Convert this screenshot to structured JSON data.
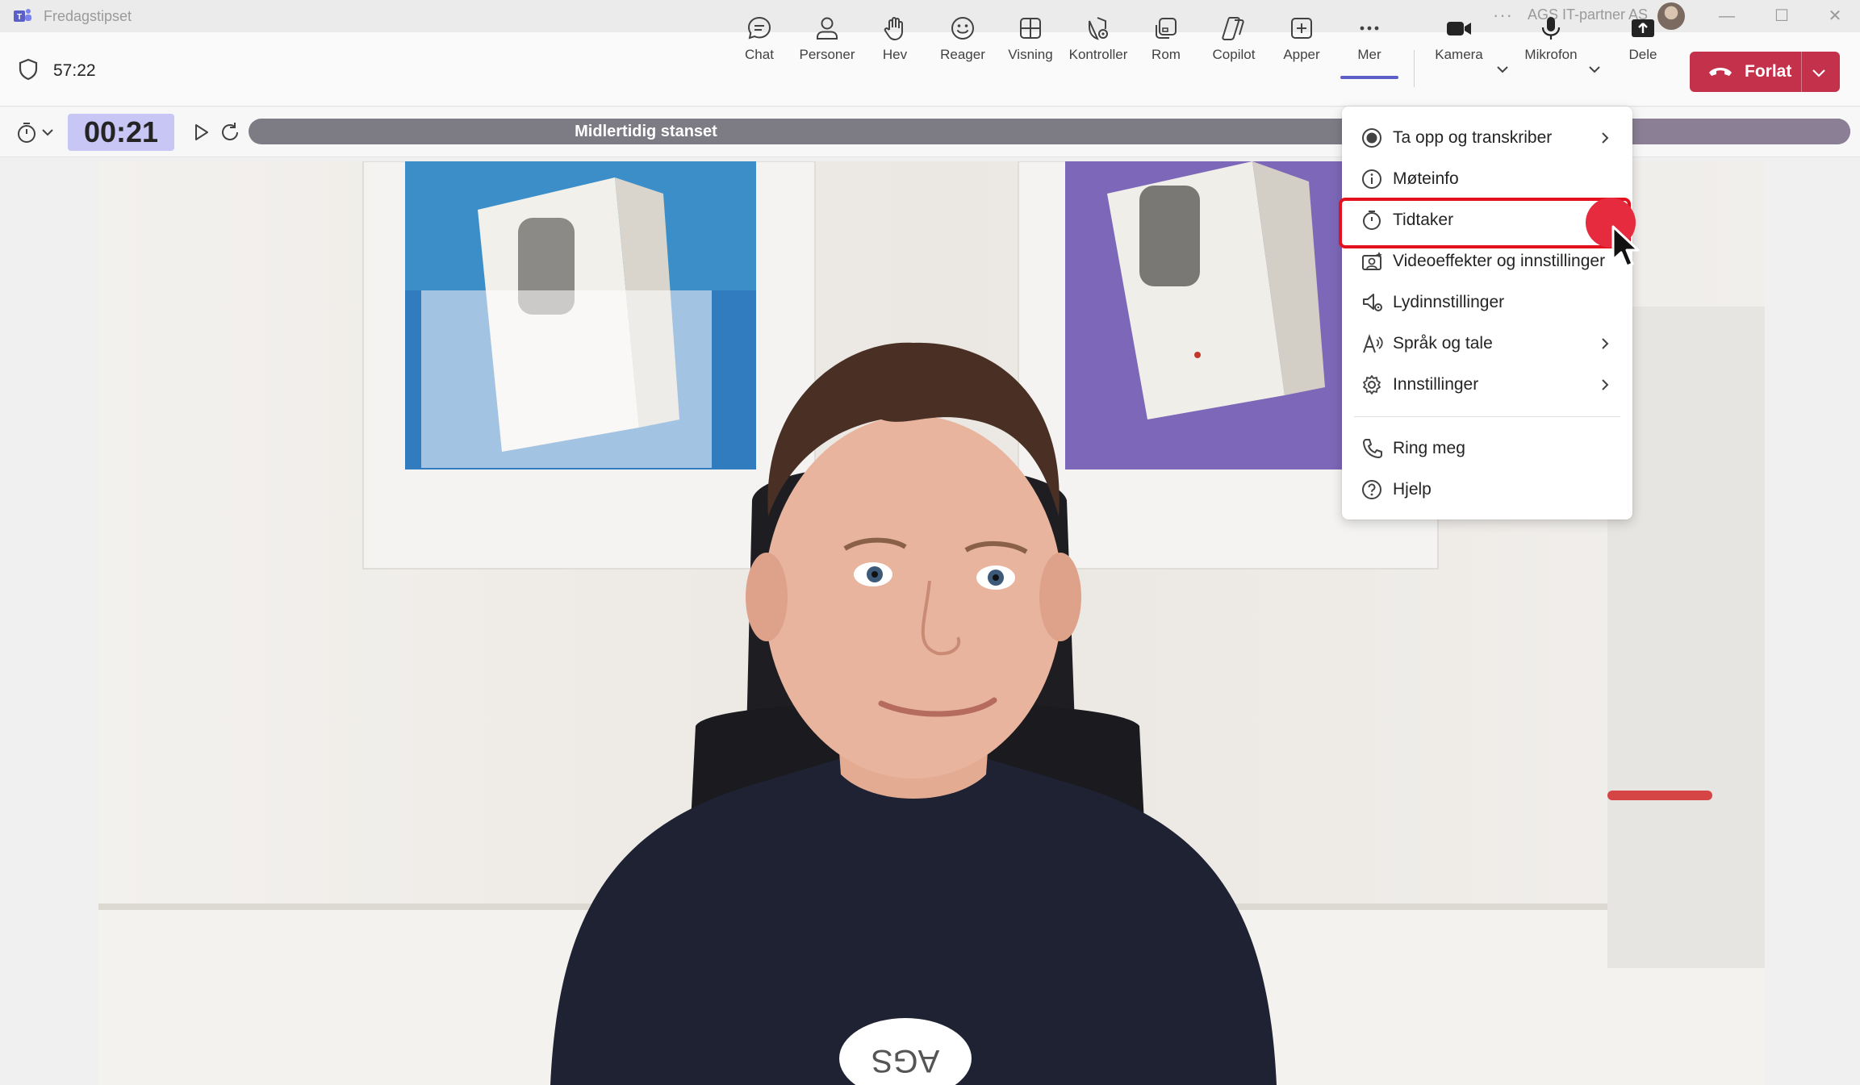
{
  "window": {
    "title": "Fredagstipset",
    "tenant": "AGS IT-partner AS",
    "more_icon": "ellipsis-icon",
    "controls": [
      "minimize-icon",
      "maximize-icon",
      "close-icon"
    ]
  },
  "meeting": {
    "duration": "57:22"
  },
  "toolbar": {
    "chat": "Chat",
    "people": "Personer",
    "raise": "Hev",
    "react": "Reager",
    "view": "Visning",
    "controls": "Kontroller",
    "rooms": "Rom",
    "copilot": "Copilot",
    "apps": "Apper",
    "more": "Mer",
    "camera": "Kamera",
    "mic": "Mikrofon",
    "share": "Dele",
    "leave": "Forlat"
  },
  "timer": {
    "value": "00:21",
    "status": "Midlertidig stanset",
    "progress_fraction": 0.62
  },
  "menu": {
    "items": [
      {
        "label": "Ta opp og transkriber",
        "icon": "record-icon",
        "submenu": true
      },
      {
        "label": "Møteinfo",
        "icon": "info-icon",
        "submenu": false
      },
      {
        "label": "Tidtaker",
        "icon": "stopwatch-icon",
        "submenu": false,
        "highlighted": true
      },
      {
        "label": "Videoeffekter og innstillinger",
        "icon": "video-effects-icon",
        "submenu": false
      },
      {
        "label": "Lydinnstillinger",
        "icon": "speaker-settings-icon",
        "submenu": false
      },
      {
        "label": "Språk og tale",
        "icon": "language-icon",
        "submenu": true
      },
      {
        "label": "Innstillinger",
        "icon": "gear-icon",
        "submenu": true
      },
      {
        "label": "Ring meg",
        "icon": "phone-icon",
        "submenu": false
      },
      {
        "label": "Hjelp",
        "icon": "help-icon",
        "submenu": false
      }
    ]
  },
  "video": {
    "shirt_text": "AGS"
  },
  "colors": {
    "accent": "#5b5fc7",
    "leave": "#c4314b",
    "timer_bg": "#c8c6f5",
    "highlight": "#e3101e"
  }
}
